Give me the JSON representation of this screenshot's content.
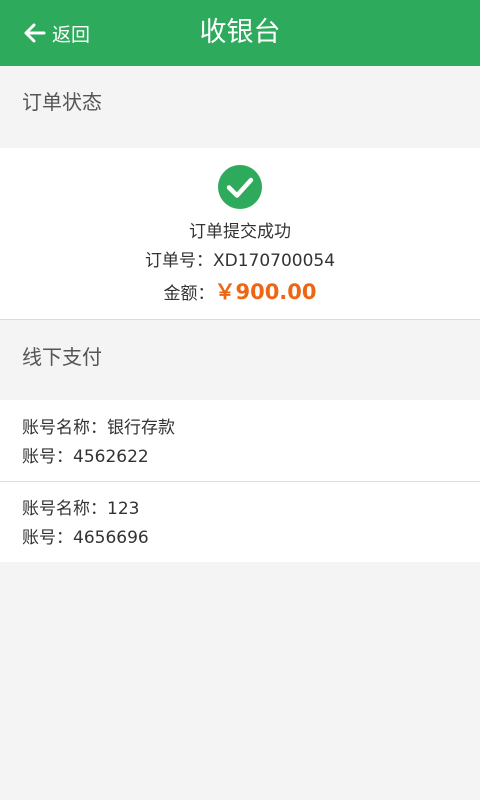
{
  "header": {
    "back_label": "返回",
    "title": "收银台",
    "color": "#2eaa5c"
  },
  "order_section": {
    "heading": "订单状态",
    "status_icon": "check-circle-icon",
    "status_text": "订单提交成功",
    "order_no_label": "订单号：",
    "order_no": "XD170700054",
    "amount_label": "金额：",
    "amount": "￥900.00",
    "amount_color": "#ee6611"
  },
  "offline_section": {
    "heading": "线下支付",
    "accounts": [
      {
        "name_label": "账号名称：",
        "name": "银行存款",
        "no_label": "账号：",
        "no": "4562622"
      },
      {
        "name_label": "账号名称：",
        "name": "123",
        "no_label": "账号：",
        "no": "4656696"
      }
    ]
  }
}
